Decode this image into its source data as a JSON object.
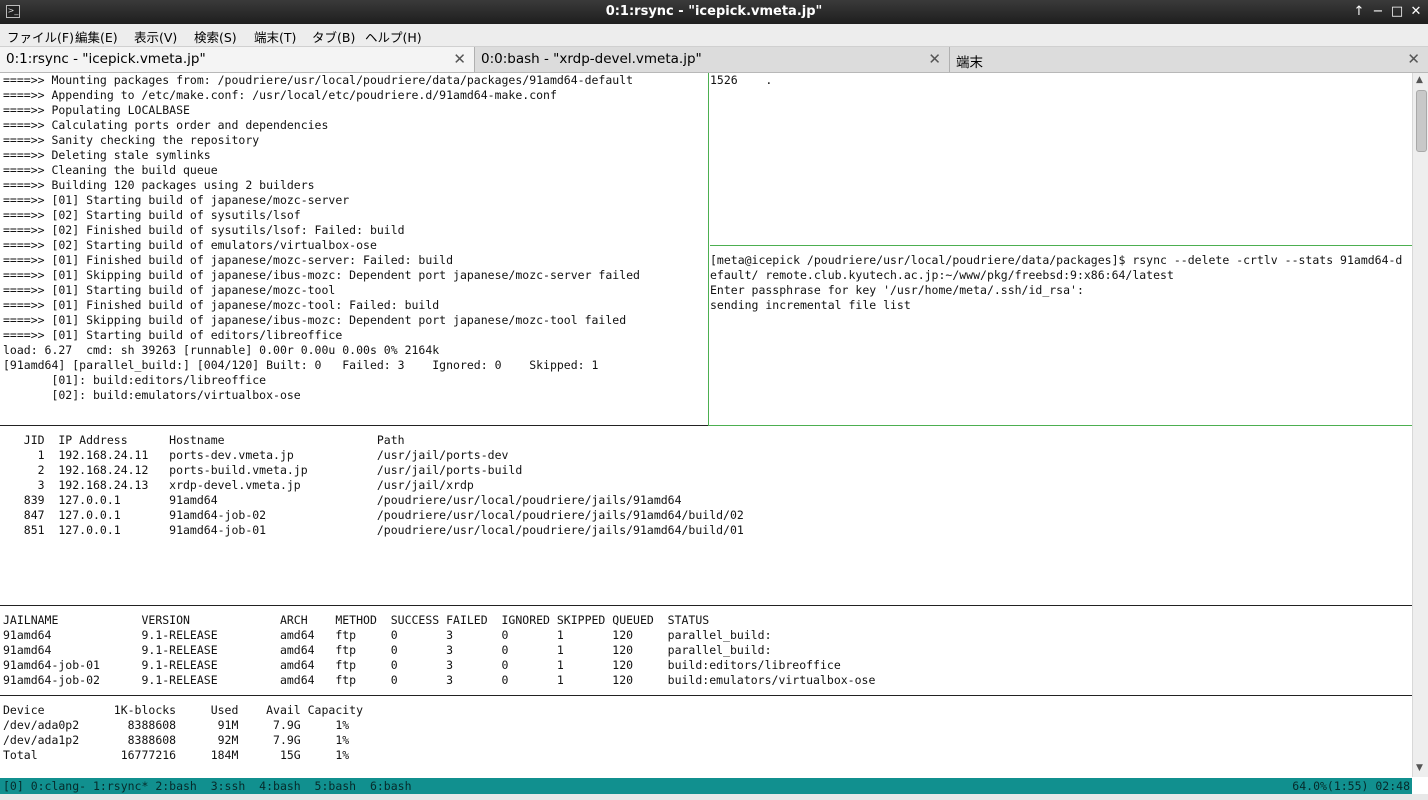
{
  "window": {
    "title": "0:1:rsync - \"icepick.vmeta.jp\"",
    "icon": "terminal-app-icon",
    "controls": {
      "up": "↑",
      "minimize": "−",
      "maximize": "□",
      "close": "✕"
    }
  },
  "menu": [
    "ファイル(F)",
    "編集(E)",
    "表示(V)",
    "検索(S)",
    "端末(T)",
    "タブ(B)",
    "ヘルプ(H)"
  ],
  "tabs": [
    {
      "label": "0:1:rsync - \"icepick.vmeta.jp\"",
      "close": "✕"
    },
    {
      "label": "0:0:bash - \"xrdp-devel.vmeta.jp\"",
      "close": "✕"
    },
    {
      "label": "端末",
      "close": "✕"
    }
  ],
  "build_log": [
    "====>> Mounting packages from: /poudriere/usr/local/poudriere/data/packages/91amd64-default",
    "====>> Appending to /etc/make.conf: /usr/local/etc/poudriere.d/91amd64-make.conf",
    "====>> Populating LOCALBASE",
    "====>> Calculating ports order and dependencies",
    "====>> Sanity checking the repository",
    "====>> Deleting stale symlinks",
    "====>> Cleaning the build queue",
    "====>> Building 120 packages using 2 builders",
    "====>> [01] Starting build of japanese/mozc-server",
    "====>> [02] Starting build of sysutils/lsof",
    "====>> [02] Finished build of sysutils/lsof: Failed: build",
    "====>> [02] Starting build of emulators/virtualbox-ose",
    "====>> [01] Finished build of japanese/mozc-server: Failed: build",
    "====>> [01] Skipping build of japanese/ibus-mozc: Dependent port japanese/mozc-server failed",
    "====>> [01] Starting build of japanese/mozc-tool",
    "====>> [01] Finished build of japanese/mozc-tool: Failed: build",
    "====>> [01] Skipping build of japanese/ibus-mozc: Dependent port japanese/mozc-tool failed",
    "====>> [01] Starting build of editors/libreoffice",
    "load: 6.27  cmd: sh 39263 [runnable] 0.00r 0.00u 0.00s 0% 2164k",
    "[91amd64] [parallel_build:] [004/120] Built: 0   Failed: 3    Ignored: 0    Skipped: 1",
    "       [01]: build:editors/libreoffice",
    "       [02]: build:emulators/virtualbox-ose"
  ],
  "right_top": [
    "1526    ."
  ],
  "rsync": [
    "[meta@icepick /poudriere/usr/local/poudriere/data/packages]$ rsync --delete -crtlv --stats 91amd64-d",
    "efault/ remote.club.kyutech.ac.jp:~/www/pkg/freebsd:9:x86:64/latest",
    "Enter passphrase for key '/usr/home/meta/.ssh/id_rsa':",
    "sending incremental file list"
  ],
  "jls": [
    "   JID  IP Address      Hostname                      Path",
    "     1  192.168.24.11   ports-dev.vmeta.jp            /usr/jail/ports-dev",
    "     2  192.168.24.12   ports-build.vmeta.jp          /usr/jail/ports-build",
    "     3  192.168.24.13   xrdp-devel.vmeta.jp           /usr/jail/xrdp",
    "   839  127.0.0.1       91amd64                       /poudriere/usr/local/poudriere/jails/91amd64",
    "   847  127.0.0.1       91amd64-job-02                /poudriere/usr/local/poudriere/jails/91amd64/build/02",
    "   851  127.0.0.1       91amd64-job-01                /poudriere/usr/local/poudriere/jails/91amd64/build/01"
  ],
  "jail_status": [
    "JAILNAME            VERSION             ARCH    METHOD  SUCCESS FAILED  IGNORED SKIPPED QUEUED  STATUS",
    "91amd64             9.1-RELEASE         amd64   ftp     0       3       0       1       120     parallel_build:",
    "91amd64             9.1-RELEASE         amd64   ftp     0       3       0       1       120     parallel_build:",
    "91amd64-job-01      9.1-RELEASE         amd64   ftp     0       3       0       1       120     build:editors/libreoffice",
    "91amd64-job-02      9.1-RELEASE         amd64   ftp     0       3       0       1       120     build:emulators/virtualbox-ose"
  ],
  "df": [
    "Device          1K-blocks     Used    Avail Capacity",
    "/dev/ada0p2       8388608      91M     7.9G     1%",
    "/dev/ada1p2       8388608      92M     7.9G     1%",
    "Total            16777216     184M      15G     1%"
  ],
  "status": {
    "left": "[0] 0:clang- 1:rsync* 2:bash  3:ssh  4:bash  5:bash  6:bash",
    "right": "64.0%(1:55) 02:48"
  },
  "colors": {
    "status_bg": "#11908f",
    "pane_border": "#4caf50",
    "titlebar": "#2b2b2b"
  }
}
